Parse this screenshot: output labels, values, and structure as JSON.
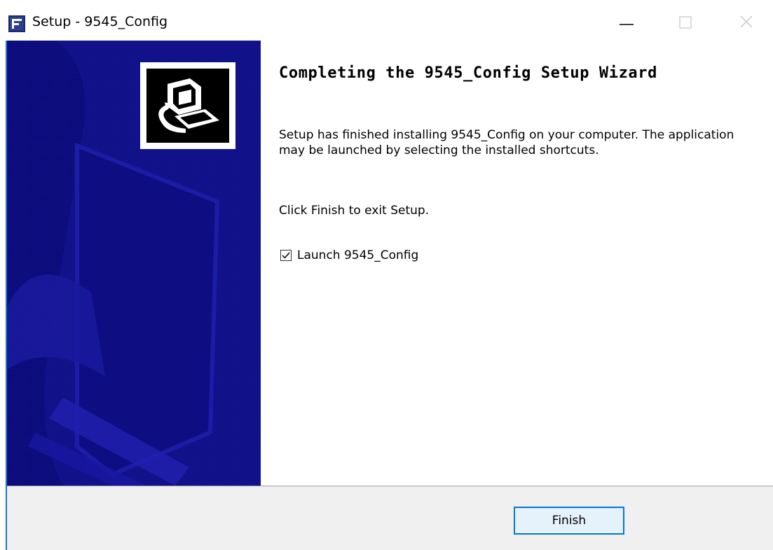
{
  "window": {
    "title": "Setup - 9545_Config",
    "app_icon": "installer-app-icon",
    "controls": {
      "minimize_icon": "minimize-icon",
      "maximize_icon": "maximize-icon",
      "close_icon": "close-icon"
    }
  },
  "banner": {
    "background_color": "#0b0b7a",
    "logo_icon": "computer-install-icon"
  },
  "content": {
    "heading": "Completing the 9545_Config Setup Wizard",
    "paragraph_1": "Setup has finished installing 9545_Config on your computer. The application may be launched by selecting the installed shortcuts.",
    "paragraph_2": "Click Finish to exit Setup.",
    "launch_checkbox": {
      "label": "Launch 9545_Config",
      "checked": true
    }
  },
  "footer": {
    "finish_label": "Finish",
    "accent_color": "#0078d7"
  }
}
